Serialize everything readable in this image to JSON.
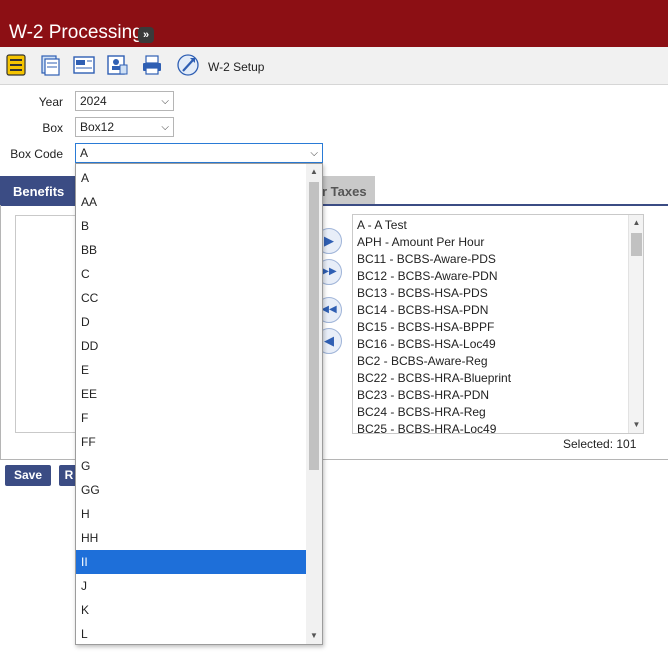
{
  "header": {
    "title": "W-2 Processing",
    "expand_glyph": "»"
  },
  "toolbar": {
    "icons": [
      "list-icon",
      "documents-icon",
      "w2-form-icon",
      "employee-card-icon",
      "printer-icon",
      "setup-wand-icon"
    ],
    "setup_label": "W-2 Setup"
  },
  "form": {
    "year_label": "Year",
    "year_value": "2024",
    "box_label": "Box",
    "box_value": "Box12",
    "box_code_label": "Box Code",
    "box_code_value": "A"
  },
  "tabs": {
    "active": "Benefits",
    "inactive": "r Taxes"
  },
  "transfer_buttons": [
    "▶",
    "▶▶",
    "◀◀",
    "◀"
  ],
  "right_list": {
    "items": [
      "A - A Test",
      "APH - Amount Per Hour",
      "BC11 - BCBS-Aware-PDS",
      "BC12 - BCBS-Aware-PDN",
      "BC13 - BCBS-HSA-PDS",
      "BC14 - BCBS-HSA-PDN",
      "BC15 - BCBS-HSA-BPPF",
      "BC16 - BCBS-HSA-Loc49",
      "BC2 - BCBS-Aware-Reg",
      "BC22 - BCBS-HRA-Blueprint",
      "BC23 - BCBS-HRA-PDN",
      "BC24 - BCBS-HRA-Reg",
      "BC25 - BCBS-HRA-Loc49"
    ]
  },
  "selected_text": "Selected: 101",
  "buttons": {
    "save": "Save",
    "second": "R"
  },
  "dropdown": {
    "options": [
      "A",
      "AA",
      "B",
      "BB",
      "C",
      "CC",
      "D",
      "DD",
      "E",
      "EE",
      "F",
      "FF",
      "G",
      "GG",
      "H",
      "HH",
      "II",
      "J",
      "K",
      "L"
    ],
    "highlighted": "II"
  },
  "colors": {
    "brand": "#8c0f14",
    "tab": "#3b4c84",
    "highlight": "#1e6fd9"
  }
}
